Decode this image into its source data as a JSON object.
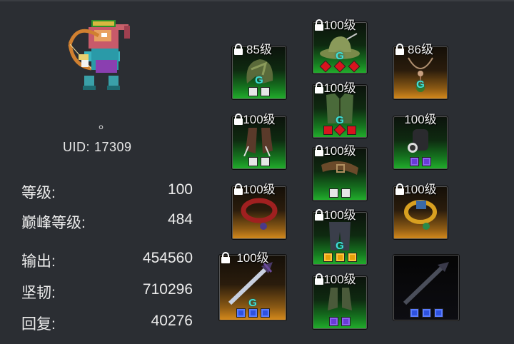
{
  "player": {
    "name": "。",
    "uid_label": "UID:",
    "uid_value": "17309"
  },
  "stats": [
    {
      "label": "等级:",
      "value": "100"
    },
    {
      "label": "巅峰等级:",
      "value": "484"
    },
    {
      "label": "输出:",
      "value": "454560"
    },
    {
      "label": "坚韧:",
      "value": "710296"
    },
    {
      "label": "回复:",
      "value": "40276"
    }
  ],
  "equipment": [
    {
      "slot": "helmet",
      "level": "85级",
      "locked": true,
      "rarity": "green",
      "gems": [
        "white",
        "white"
      ]
    },
    {
      "slot": "hat",
      "level": "100级",
      "locked": true,
      "rarity": "green",
      "gems": [
        "red",
        "red",
        "red"
      ]
    },
    {
      "slot": "necklace",
      "level": "86级",
      "locked": true,
      "rarity": "orange",
      "gems": []
    },
    {
      "slot": "armor",
      "level": "100级",
      "locked": true,
      "rarity": "green",
      "gems": [
        "redsq",
        "red",
        "redsq"
      ]
    },
    {
      "slot": "gloves",
      "level": "100级",
      "locked": true,
      "rarity": "green",
      "gems": [
        "white",
        "white"
      ]
    },
    {
      "slot": "belt",
      "level": "100级",
      "locked": true,
      "rarity": "green",
      "gems": [
        "white",
        "white"
      ]
    },
    {
      "slot": "bracer",
      "level": "100级",
      "locked": false,
      "rarity": "green",
      "gems": [
        "purple",
        "purple"
      ]
    },
    {
      "slot": "ring-left",
      "level": "100级",
      "locked": true,
      "rarity": "orange",
      "gems": []
    },
    {
      "slot": "pants",
      "level": "100级",
      "locked": true,
      "rarity": "green",
      "gems": [
        "gold",
        "gold",
        "gold"
      ]
    },
    {
      "slot": "ring-right",
      "level": "100级",
      "locked": true,
      "rarity": "orange",
      "gems": []
    },
    {
      "slot": "weapon",
      "level": "100级",
      "locked": true,
      "rarity": "orange",
      "gems": [
        "blue",
        "blue",
        "blue"
      ]
    },
    {
      "slot": "boots",
      "level": "100级",
      "locked": true,
      "rarity": "green",
      "gems": [
        "purple",
        "purple"
      ]
    },
    {
      "slot": "offhand-weapon",
      "level": "",
      "locked": false,
      "rarity": "black",
      "gems": [
        "blue",
        "blue",
        "blue"
      ]
    }
  ],
  "icons": {
    "lock": "lock-icon",
    "gem_mark": "G"
  },
  "colors": {
    "green_rarity": "#22b02c",
    "orange_rarity": "#d88c1c",
    "text": "#ececec",
    "background": "#2b2e33"
  }
}
